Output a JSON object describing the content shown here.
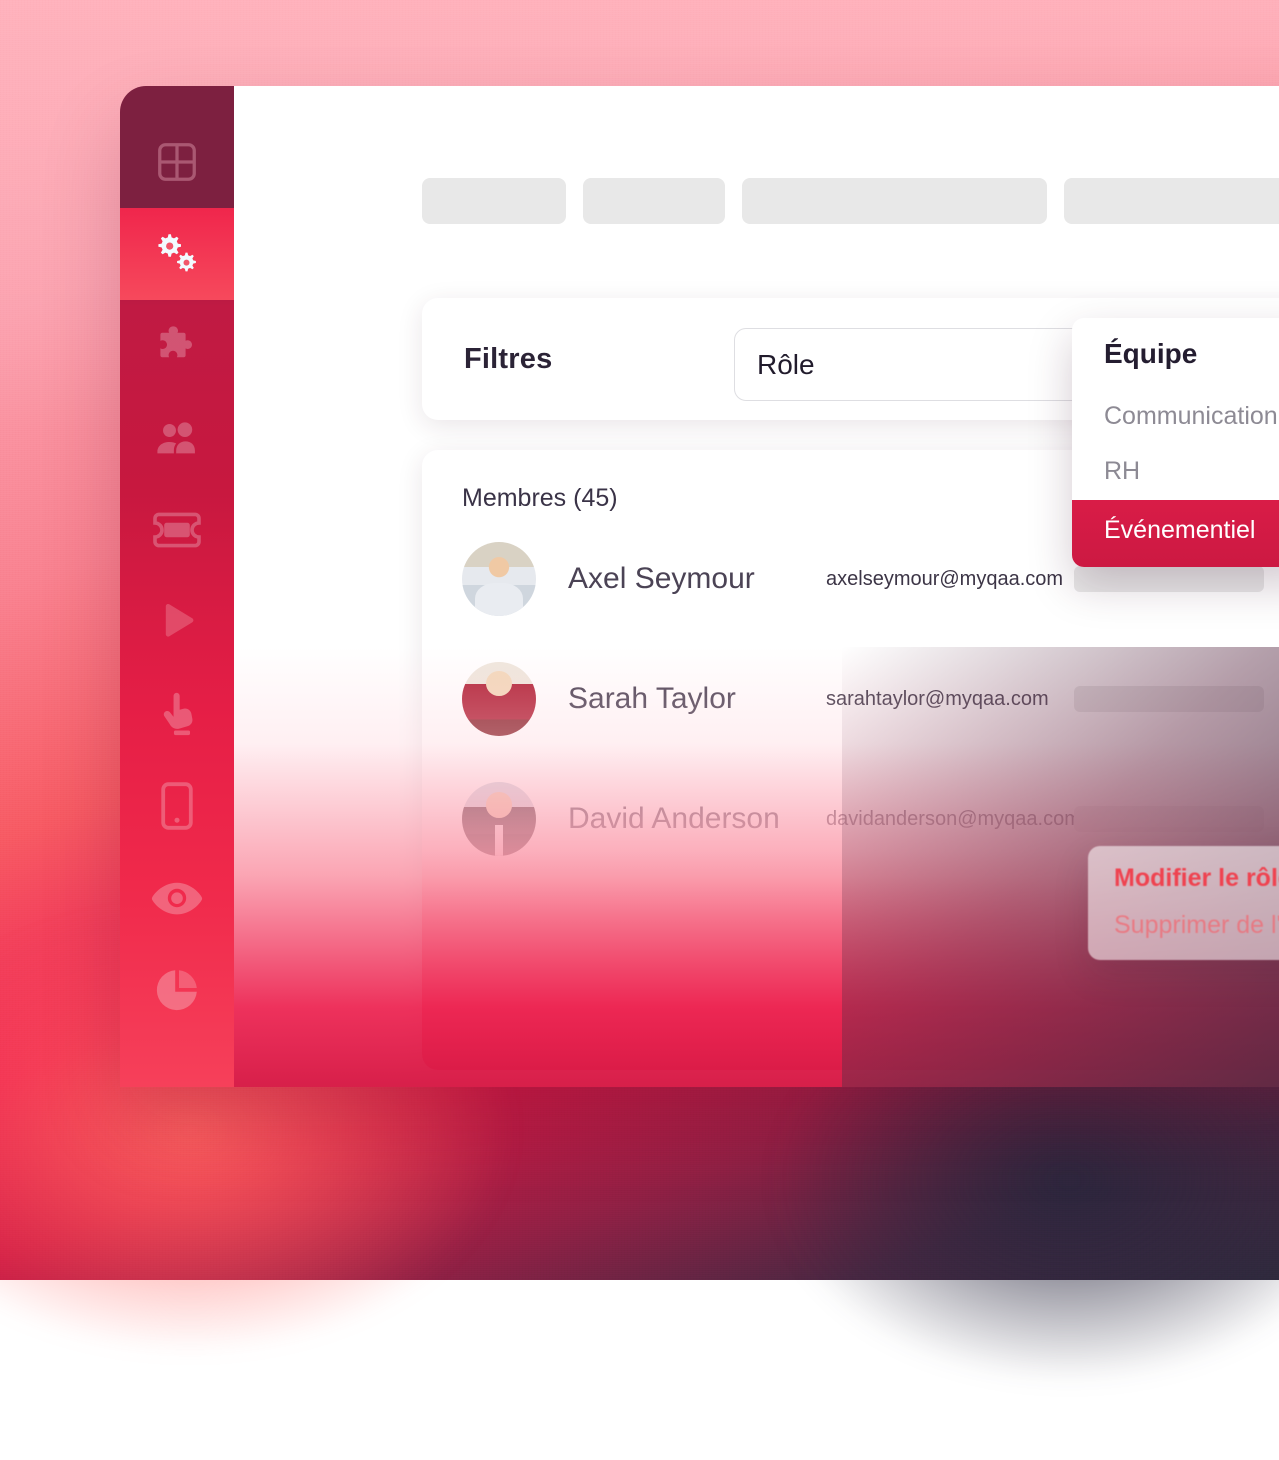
{
  "sidebar": {
    "items": [
      {
        "name": "dashboard",
        "icon": "grid-icon",
        "active": false
      },
      {
        "name": "settings",
        "icon": "gears-icon",
        "active": true
      },
      {
        "name": "plugins",
        "icon": "puzzle-icon",
        "active": false
      },
      {
        "name": "members",
        "icon": "people-icon",
        "active": false
      },
      {
        "name": "tickets",
        "icon": "ticket-icon",
        "active": false
      },
      {
        "name": "media",
        "icon": "play-icon",
        "active": false
      },
      {
        "name": "interact",
        "icon": "hand-pointer-icon",
        "active": false
      },
      {
        "name": "mobile",
        "icon": "phone-icon",
        "active": false
      },
      {
        "name": "preview",
        "icon": "eye-icon",
        "active": false
      },
      {
        "name": "analytics",
        "icon": "pie-chart-icon",
        "active": false
      }
    ]
  },
  "filters": {
    "label": "Filtres",
    "role_select": {
      "value": "Rôle",
      "chevron": "chevron-down-icon"
    }
  },
  "members": {
    "title": "Membres (45)",
    "rows": [
      {
        "name": "Axel Seymour",
        "email": "axelseymour@myqaa.com",
        "avatar": "avatar-axel"
      },
      {
        "name": "Sarah Taylor",
        "email": "sarahtaylor@myqaa.com",
        "avatar": "avatar-sarah"
      },
      {
        "name": "David Anderson",
        "email": "davidanderson@myqaa.com",
        "avatar": "avatar-david"
      }
    ]
  },
  "team_dropdown": {
    "title": "Équipe",
    "options": [
      {
        "label": "Communication",
        "selected": false
      },
      {
        "label": "RH",
        "selected": false
      },
      {
        "label": "Événementiel",
        "selected": true
      }
    ]
  },
  "context_menu": {
    "items": [
      {
        "label": "Modifier le rôle",
        "variant": "primary"
      },
      {
        "label": "Supprimer de l'équipe",
        "variant": "secondary"
      }
    ]
  },
  "colors": {
    "brand_crimson": "#d91c47",
    "brand_red": "#ef4350",
    "sidebar_top": "#7d2040",
    "skeleton_grey": "#e8e8e8",
    "text_dark": "#2b2336"
  }
}
